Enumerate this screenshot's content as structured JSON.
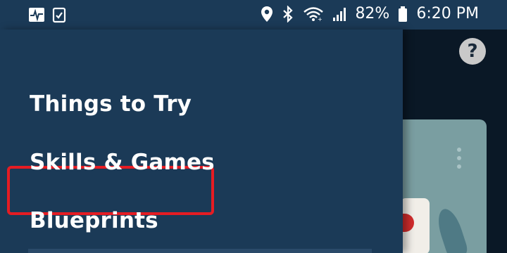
{
  "status_bar": {
    "left_icons": [
      "activity-monitor-icon",
      "clipboard-check-icon"
    ],
    "right_icons": [
      "location-pin-icon",
      "bluetooth-icon",
      "wifi-icon",
      "signal-bars-icon",
      "battery-icon"
    ],
    "battery_percent": "82%",
    "time": "6:20 PM"
  },
  "background_app": {
    "help_label": "?",
    "card_menu_icon": "vertical-dots-icon"
  },
  "drawer": {
    "items": [
      {
        "label": "Things to Try"
      },
      {
        "label": "Skills & Games",
        "highlighted": true
      },
      {
        "label": "Blueprints"
      }
    ],
    "highlight_color": "#e51c23",
    "background_color": "#1b3a57"
  }
}
